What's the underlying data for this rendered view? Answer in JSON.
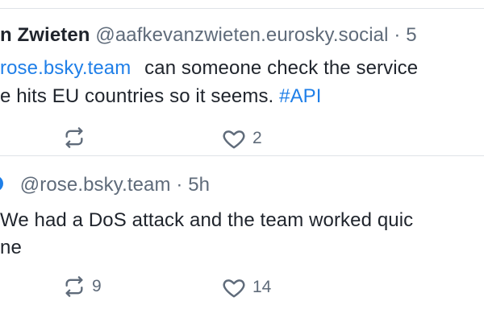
{
  "post1": {
    "author_name": "n Zwieten",
    "author_handle": "@aafkevanzwieten.eurosky.social",
    "time": "· 5",
    "text_mention": "rose.bsky.team",
    "text_line1": "can someone check the service",
    "text_line2": "e hits EU countries so it seems.",
    "hashtag": "#API",
    "retweet_count": "",
    "like_count": "2"
  },
  "post2": {
    "author_handle": "@rose.bsky.team",
    "time": "· 5h",
    "text_line1": "We had a DoS attack and the team worked quic",
    "text_line2": "ne",
    "retweet_count": "9",
    "like_count": "14"
  },
  "icons": {
    "repost": "repost-icon",
    "like": "heart-icon",
    "verified": "verified-badge-icon"
  },
  "colors": {
    "text": "#1f242c",
    "muted": "#5f6b7a",
    "accent": "#1f7fe8",
    "divider": "#dfe3e8"
  }
}
